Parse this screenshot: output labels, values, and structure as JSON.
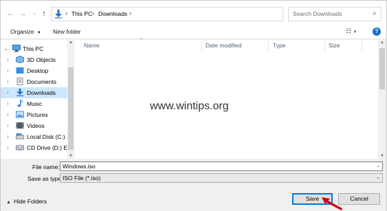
{
  "address_bar": {
    "crumbs": [
      "This PC",
      "Downloads"
    ],
    "search_placeholder": "Search Downloads"
  },
  "toolbar": {
    "organize_label": "Organize",
    "new_folder_label": "New folder",
    "help_label": "?"
  },
  "tree": {
    "items": [
      {
        "label": "This PC",
        "icon": "computer-icon"
      },
      {
        "label": "3D Objects",
        "icon": "cube-folder-icon"
      },
      {
        "label": "Desktop",
        "icon": "desktop-folder-icon"
      },
      {
        "label": "Documents",
        "icon": "documents-folder-icon"
      },
      {
        "label": "Downloads",
        "icon": "download-arrow-icon",
        "selected": true
      },
      {
        "label": "Music",
        "icon": "music-note-icon"
      },
      {
        "label": "Pictures",
        "icon": "pictures-folder-icon"
      },
      {
        "label": "Videos",
        "icon": "videos-folder-icon"
      },
      {
        "label": "Local Disk (C:)",
        "icon": "drive-icon"
      },
      {
        "label": "CD Drive (D:) ESI",
        "icon": "cd-drive-icon"
      }
    ]
  },
  "file_list": {
    "columns": [
      "Name",
      "Date modified",
      "Type",
      "Size"
    ],
    "watermark": "www.wintips.org"
  },
  "form": {
    "file_name_label": "File name:",
    "file_name_value": "Windows.iso",
    "save_as_type_label": "Save as type:",
    "save_as_type_value": "ISO File (*.iso)"
  },
  "footer": {
    "hide_folders_label": "Hide Folders",
    "save_label": "Save",
    "cancel_label": "Cancel"
  },
  "colors": {
    "accent": "#0078d7",
    "selection": "#cce8ff",
    "annotation_arrow": "#d0021b"
  }
}
